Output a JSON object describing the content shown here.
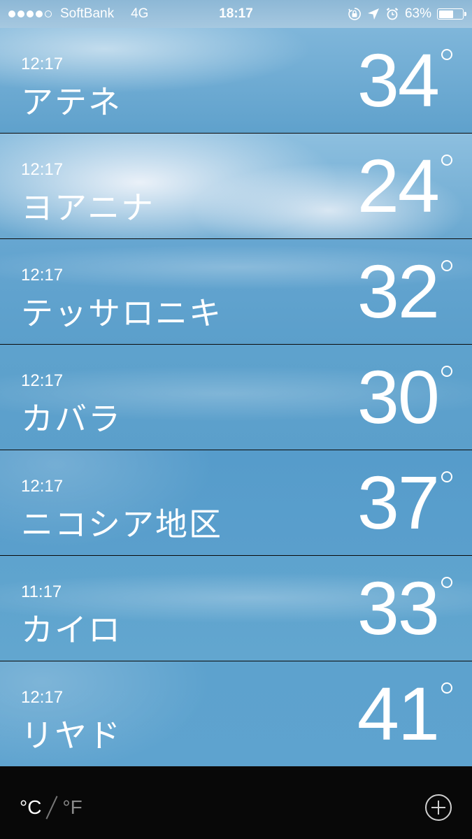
{
  "status_bar": {
    "carrier": "SoftBank",
    "network": "4G",
    "time": "18:17",
    "battery_percent": "63%",
    "battery_level": 0.63,
    "signal_bars_filled": 4,
    "signal_bars_total": 5,
    "icons": [
      "orientation-lock-icon",
      "location-arrow-icon",
      "alarm-icon",
      "battery-icon"
    ]
  },
  "cities": [
    {
      "time": "12:17",
      "name": "アテネ",
      "temp": "34"
    },
    {
      "time": "12:17",
      "name": "ヨアニナ",
      "temp": "24"
    },
    {
      "time": "12:17",
      "name": "テッサロニキ",
      "temp": "32"
    },
    {
      "time": "12:17",
      "name": "カバラ",
      "temp": "30"
    },
    {
      "time": "12:17",
      "name": "ニコシア地区",
      "temp": "37"
    },
    {
      "time": "11:17",
      "name": "カイロ",
      "temp": "33"
    },
    {
      "time": "12:17",
      "name": "リヤド",
      "temp": "41"
    }
  ],
  "toolbar": {
    "celsius_label": "°C",
    "fahrenheit_label": "°F",
    "add_icon": "plus-circle-icon"
  },
  "colors": {
    "sky": "#5fa4cf",
    "toolbar_bg": "#080808",
    "inactive_unit": "#8a8a8a"
  }
}
